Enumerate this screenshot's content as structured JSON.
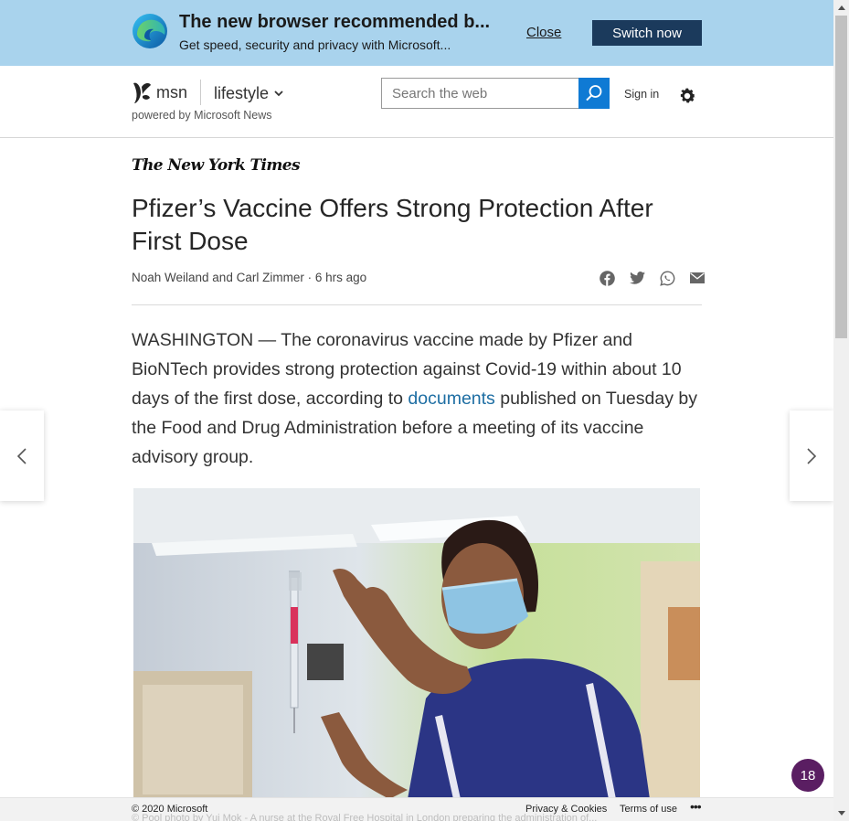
{
  "banner": {
    "title": "The new browser recommended b...",
    "subtitle": "Get speed, security and privacy with Microsoft...",
    "close_label": "Close",
    "switch_label": "Switch now",
    "logo_icon": "microsoft-edge-icon"
  },
  "header": {
    "brand": "msn",
    "category": "lifestyle",
    "powered_by": "powered by Microsoft News",
    "search_placeholder": "Search the web",
    "signin_label": "Sign in"
  },
  "article": {
    "source": "The New York Times",
    "headline": "Pfizer’s Vaccine Offers Strong Protection After First Dose",
    "byline": "Noah Weiland and Carl Zimmer · 6 hrs ago",
    "body_before_link": "WASHINGTON — The coronavirus vaccine made by Pfizer and BioNTech provides strong protection against Covid-19 within about 10 days of the first dose, according to ",
    "link_text": "documents",
    "body_after_link": " published on Tuesday by the Food and Drug Administration before a meeting of its vaccine advisory group.",
    "photo_caption": "© Pool photo by Yui Mok - A nurse at the Royal Free Hospital in London preparing the administration of..."
  },
  "footer": {
    "copyright": "© 2020 Microsoft",
    "privacy": "Privacy & Cookies",
    "terms": "Terms of use",
    "more": "•••"
  },
  "badge": {
    "count": "18"
  },
  "colors": {
    "banner_bg": "#a9d3ed",
    "switch_button": "#1b3a5c",
    "search_button": "#0f7ad4",
    "link": "#1e6ea3",
    "badge": "#5a1e62"
  }
}
